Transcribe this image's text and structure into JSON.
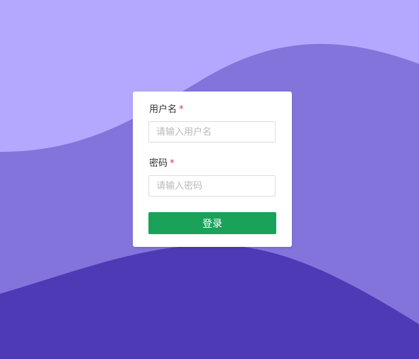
{
  "colors": {
    "background_top": "#b4a8fe",
    "wave_middle": "#8374dc",
    "wave_bottom": "#4f3ab5",
    "card_background": "#ffffff",
    "required_marker": "#e0315a",
    "login_button": "#1aa259"
  },
  "login_form": {
    "username": {
      "label": "用户名",
      "required_mark": "*",
      "placeholder": "请输入用户名",
      "value": ""
    },
    "password": {
      "label": "密码",
      "required_mark": "*",
      "placeholder": "请输入密码",
      "value": ""
    },
    "submit_label": "登录"
  }
}
